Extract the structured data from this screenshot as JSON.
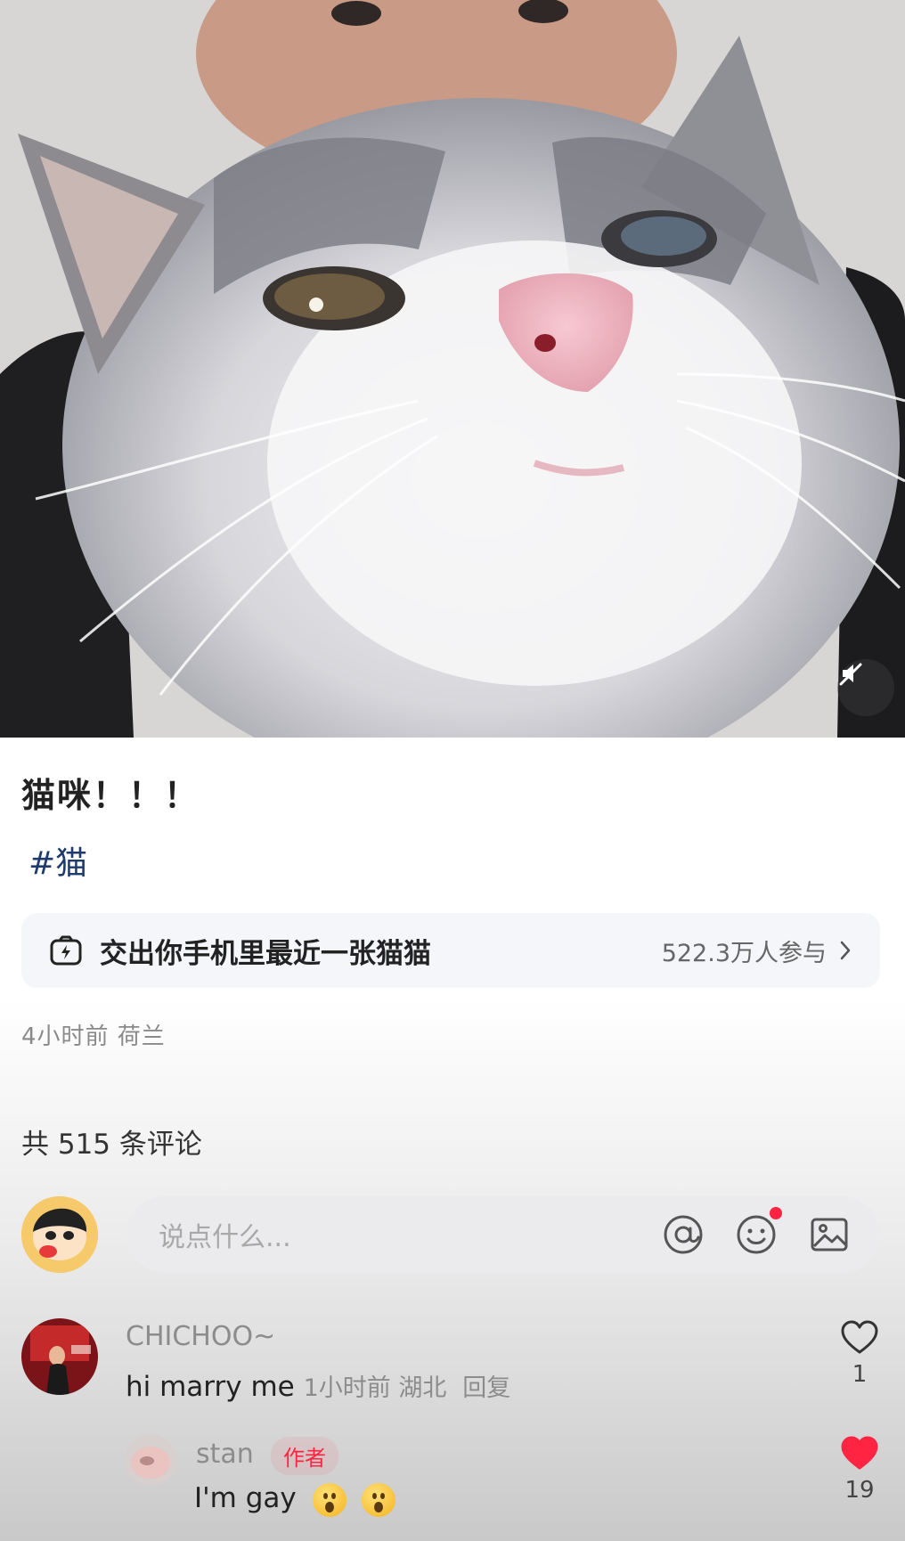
{
  "post": {
    "title": "猫咪！！！",
    "tag": "#猫",
    "topic": {
      "label": "交出你手机里最近一张猫猫",
      "participants": "522.3万人参与"
    },
    "meta": "4小时前 荷兰"
  },
  "comments_section": {
    "count_label": "共 515 条评论",
    "input_placeholder": "说点什么..."
  },
  "comments": [
    {
      "user": "CHICHOO~",
      "text": "hi marry me",
      "time_location": "1小时前 湖北",
      "reply_label": "回复",
      "likes": "1",
      "liked": false
    }
  ],
  "replies": [
    {
      "user": "stan",
      "badge": "作者",
      "text": "I'm gay",
      "likes": "19",
      "liked": true
    }
  ],
  "icons": {
    "mute": "speaker-muted-icon",
    "topic": "lightning-camera-icon",
    "mention": "at-icon",
    "emoji": "smiley-icon",
    "image": "image-icon",
    "like": "heart-icon"
  },
  "colors": {
    "accent_red": "#ff2442",
    "tag_blue": "#1f3a6e"
  }
}
